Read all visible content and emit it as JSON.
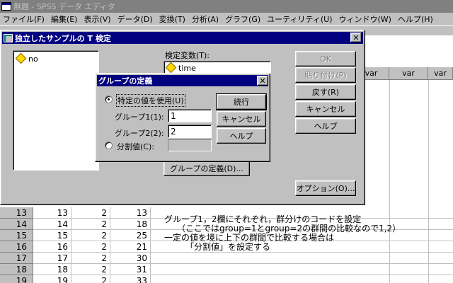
{
  "app": {
    "title": "無題 - SPSS データ エディタ"
  },
  "menu": [
    "ファイル(F)",
    "編集(E)",
    "表示(V)",
    "データ(D)",
    "変換(T)",
    "分析(A)",
    "グラフ(G)",
    "ユーティリティ(U)",
    "ウィンドウ(W)",
    "ヘルプ(H)"
  ],
  "grid": {
    "var_header": "var",
    "rows": [
      {
        "num": "13",
        "c1": "13",
        "c2": "2",
        "c3": "13"
      },
      {
        "num": "14",
        "c1": "14",
        "c2": "2",
        "c3": "18"
      },
      {
        "num": "15",
        "c1": "15",
        "c2": "2",
        "c3": "25"
      },
      {
        "num": "16",
        "c1": "16",
        "c2": "2",
        "c3": "21"
      },
      {
        "num": "17",
        "c1": "17",
        "c2": "2",
        "c3": "30"
      },
      {
        "num": "18",
        "c1": "18",
        "c2": "2",
        "c3": "31"
      },
      {
        "num": "19",
        "c1": "19",
        "c2": "2",
        "c3": "33"
      }
    ]
  },
  "ttest_dialog": {
    "title": "独立したサンプルの T 検定",
    "source_list": [
      "no"
    ],
    "test_var_label": "検定変数(T):",
    "test_vars": [
      "time"
    ],
    "buttons": {
      "ok": "OK",
      "paste": "貼り付け(P)",
      "reset": "戻す(R)",
      "cancel": "キャンセル",
      "help": "ヘルプ",
      "define_groups": "グループの定義(D)...",
      "options": "オプション(O)..."
    }
  },
  "define_dialog": {
    "title": "グループの定義",
    "use_specified": "特定の値を使用(U)",
    "group1_label": "グループ1(1):",
    "group1_value": "1",
    "group2_label": "グループ2(2):",
    "group2_value": "2",
    "cutpoint_label": "分割値(C):",
    "cutpoint_value": "",
    "buttons": {
      "continue": "続行",
      "cancel": "キャンセル",
      "help": "ヘルプ"
    }
  },
  "annotation": {
    "line1": "グループ1，2欄にそれぞれ，群分けのコードを設定",
    "line2": "（ここではgroup=1とgroup=2の群間の比較なので1,2）",
    "line3": "一定の値を境に上下の群間で比較する場合は",
    "line4": "「分割値」を設定する"
  }
}
